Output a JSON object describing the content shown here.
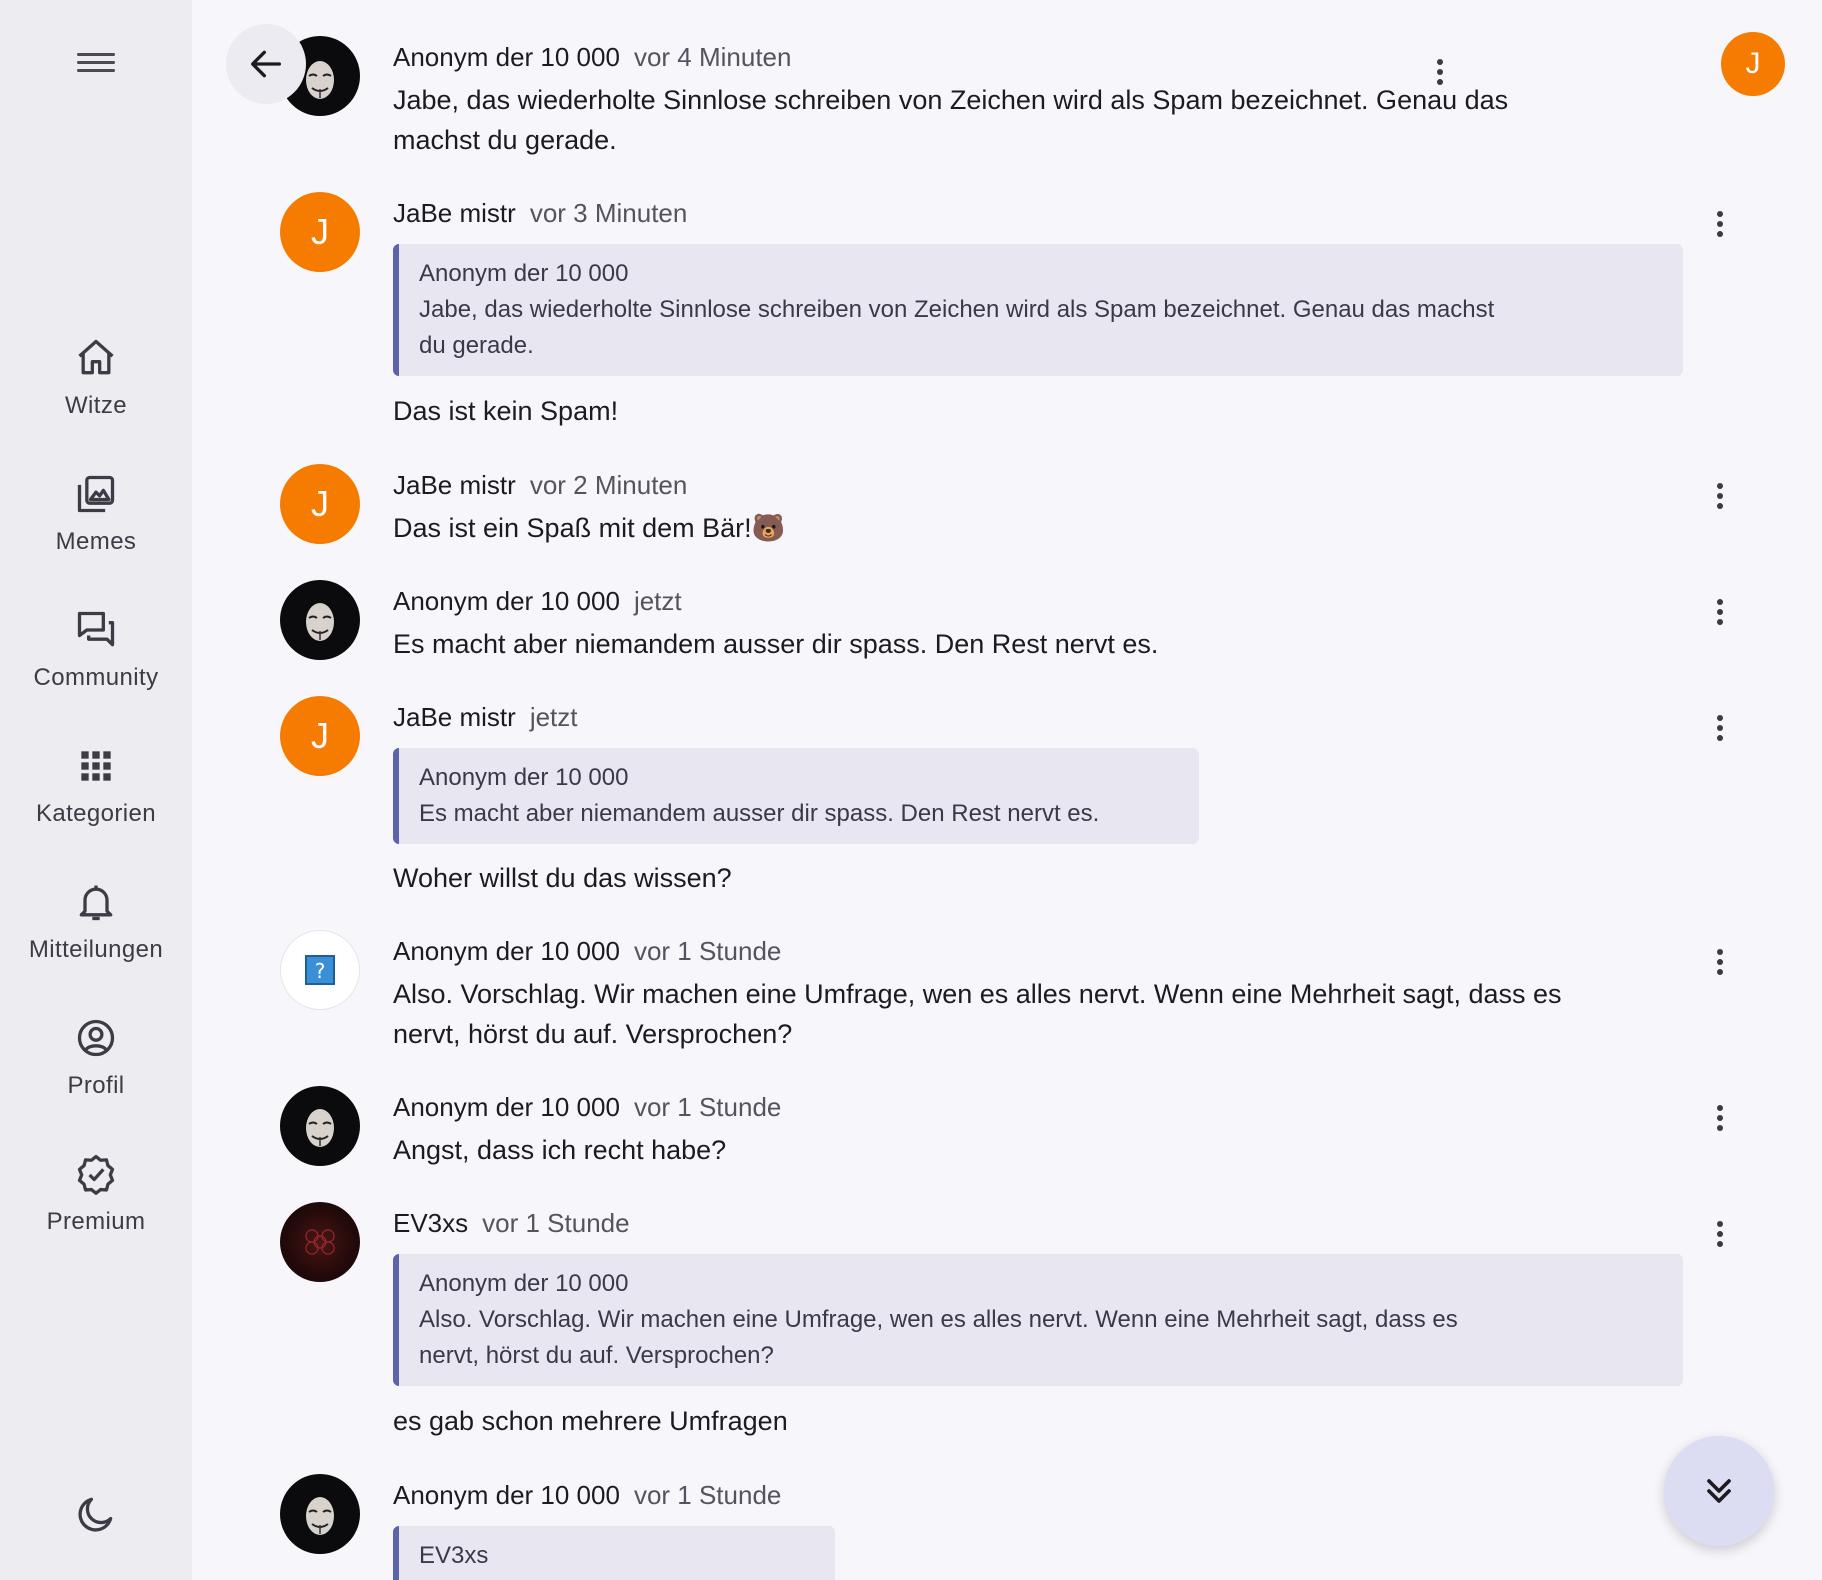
{
  "sidebar": {
    "items": [
      {
        "label": "Witze",
        "icon": "home-icon"
      },
      {
        "label": "Memes",
        "icon": "images-icon"
      },
      {
        "label": "Community",
        "icon": "forum-icon"
      },
      {
        "label": "Kategorien",
        "icon": "grid-icon"
      },
      {
        "label": "Mitteilungen",
        "icon": "bell-icon"
      },
      {
        "label": "Profil",
        "icon": "profile-icon"
      },
      {
        "label": "Premium",
        "icon": "verified-badge-icon"
      }
    ]
  },
  "header": {
    "user_initial": "J",
    "accent_color": "#f57c00"
  },
  "comments": [
    {
      "author": "Anonym der 10 000",
      "time": "vor 4 Minuten",
      "avatar": "anon",
      "lines": [
        "Jabe, das wiederholte Sinnlose schreiben von Zeichen wird als Spam bezeichnet. Genau das",
        "machst du gerade."
      ]
    },
    {
      "author": "JaBe mistr",
      "time": "vor 3 Minuten",
      "avatar": "J",
      "quote": {
        "author": "Anonym der 10 000",
        "lines": [
          "Jabe, das wiederholte Sinnlose schreiben von Zeichen wird als Spam bezeichnet. Genau das machst",
          "du gerade."
        ]
      },
      "lines": [
        "Das ist kein Spam!"
      ]
    },
    {
      "author": "JaBe mistr",
      "time": "vor 2 Minuten",
      "avatar": "J",
      "lines": [
        "Das ist ein Spaß mit dem Bär!🐻"
      ]
    },
    {
      "author": "Anonym der 10 000",
      "time": "jetzt",
      "avatar": "anon",
      "lines": [
        "Es macht aber niemandem ausser dir spass. Den Rest nervt es."
      ]
    },
    {
      "author": "JaBe mistr",
      "time": "jetzt",
      "avatar": "J",
      "quote": {
        "author": "Anonym der 10 000",
        "lines": [
          "Es macht aber niemandem ausser dir spass. Den Rest nervt es."
        ]
      },
      "lines": [
        "Woher willst du das wissen?"
      ]
    },
    {
      "author": "Anonym der 10 000",
      "time": "vor 1 Stunde",
      "avatar": "unknown",
      "lines": [
        "Also. Vorschlag. Wir machen eine Umfrage, wen es alles nervt. Wenn eine Mehrheit sagt, dass es",
        "nervt, hörst du auf. Versprochen?"
      ]
    },
    {
      "author": "Anonym der 10 000",
      "time": "vor 1 Stunde",
      "avatar": "anon",
      "lines": [
        "Angst, dass ich recht habe?"
      ]
    },
    {
      "author": "EV3xs",
      "time": "vor 1 Stunde",
      "avatar": "ev",
      "quote": {
        "author": "Anonym der 10 000",
        "lines": [
          "Also. Vorschlag. Wir machen eine Umfrage, wen es alles nervt. Wenn eine Mehrheit sagt, dass es",
          "nervt, hörst du auf. Versprochen?"
        ]
      },
      "lines": [
        "es gab schon mehrere Umfragen"
      ]
    },
    {
      "author": "Anonym der 10 000",
      "time": "vor 1 Stunde",
      "avatar": "anon",
      "quote": {
        "author": "EV3xs",
        "lines": []
      },
      "lines": []
    }
  ]
}
